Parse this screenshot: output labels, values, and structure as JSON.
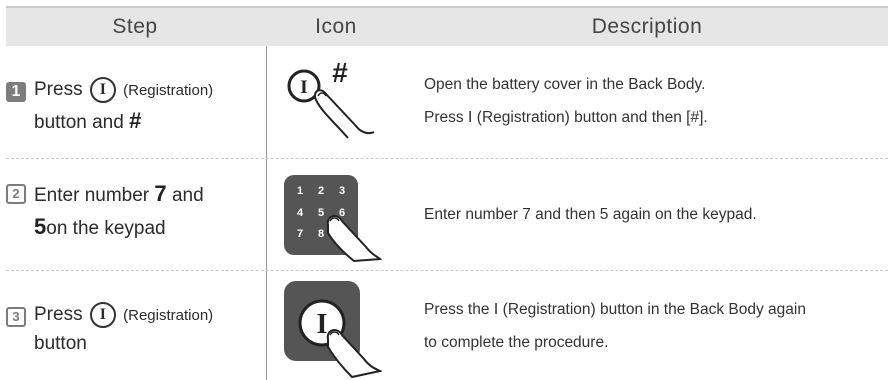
{
  "header": {
    "step": "Step",
    "icon": "Icon",
    "description": "Description"
  },
  "rows": [
    {
      "number": "1",
      "step_press": "Press",
      "step_reg": "(Registration)",
      "step_line2": "button and",
      "step_hash": "#",
      "desc_line1": "Open the battery cover in the Back Body.",
      "desc_line2": "Press Ⅰ (Registration) button and then [#].",
      "icon_i": "I",
      "icon_hash": "#"
    },
    {
      "number": "2",
      "step_line1": "Enter number",
      "step_seven": "7",
      "step_and": "and",
      "step_five": "5",
      "step_line2": "on the keypad",
      "desc_line1": "Enter number 7 and then 5 again on the keypad.",
      "keys": [
        "1",
        "2",
        "3",
        "4",
        "5",
        "6",
        "7",
        "8"
      ]
    },
    {
      "number": "3",
      "step_press": "Press",
      "step_reg": "(Registration)",
      "step_line2": "button",
      "desc_line1": "Press the Ⅰ (Registration) button in the Back Body again",
      "desc_line2": "to complete the procedure.",
      "icon_i": "I"
    }
  ],
  "colors": {
    "header_bg": "#e6e6e6",
    "badge": "#7d7d7d",
    "keypad": "#555555"
  },
  "icons": [
    "registration-button-icon",
    "hash-icon",
    "finger-icon",
    "keypad-icon"
  ]
}
